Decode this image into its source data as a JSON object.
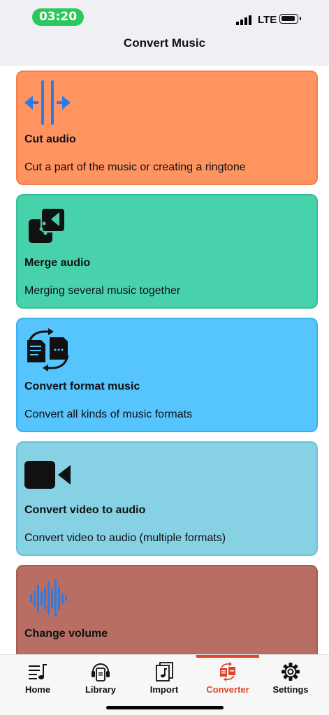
{
  "status_bar": {
    "time": "03:20",
    "network": "LTE",
    "time_pill_color": "#2bc95b"
  },
  "nav": {
    "title": "Convert Music"
  },
  "cards": [
    {
      "title": "Cut audio",
      "description": "Cut a part of the music or creating a ringtone",
      "bg": "#ff9461",
      "border": "#f57f47",
      "icon": "cut-audio-icon"
    },
    {
      "title": "Merge audio",
      "description": "Merging several music together",
      "bg": "#48d2ac",
      "border": "#33be95",
      "icon": "merge-icon"
    },
    {
      "title": "Convert format music",
      "description": "Convert all kinds of music formats",
      "bg": "#56c4fd",
      "border": "#3ab1ee",
      "icon": "convert-format-icon"
    },
    {
      "title": "Convert video to audio",
      "description": "Convert video to audio (multiple formats)",
      "bg": "#86d1e3",
      "border": "#6cc1d6",
      "icon": "video-camera-icon"
    },
    {
      "title": "Change volume",
      "description": "",
      "bg": "#b86e62",
      "border": "#a85a4e",
      "icon": "sound-wave-icon"
    }
  ],
  "tab_bar": {
    "tabs": [
      {
        "label": "Home",
        "icon": "music-list-icon",
        "active": false
      },
      {
        "label": "Library",
        "icon": "library-icon",
        "active": false
      },
      {
        "label": "Import",
        "icon": "import-icon",
        "active": false
      },
      {
        "label": "Converter",
        "icon": "converter-icon",
        "active": true
      },
      {
        "label": "Settings",
        "icon": "gear-icon",
        "active": false
      }
    ],
    "active_color": "#e0442c",
    "inactive_color": "#111111"
  }
}
